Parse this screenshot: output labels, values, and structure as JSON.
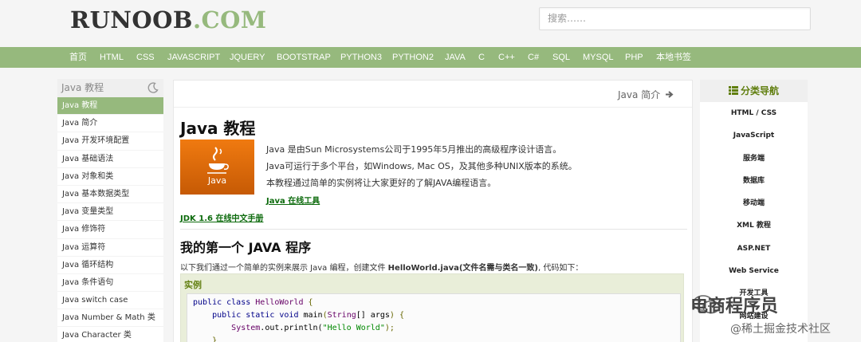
{
  "header": {
    "logo_part1": "RUNOOB",
    "logo_part2": ".COM",
    "search_placeholder": "搜索……"
  },
  "nav": {
    "items": [
      "首页",
      "HTML",
      "CSS",
      "JAVASCRIPT",
      "JQUERY",
      "BOOTSTRAP",
      "PYTHON3",
      "PYTHON2",
      "JAVA",
      "C",
      "C++",
      "C#",
      "SQL",
      "MYSQL",
      "PHP",
      "本地书签"
    ]
  },
  "sidebar": {
    "title": "Java 教程",
    "items": [
      "Java 教程",
      "Java 简介",
      "Java 开发环境配置",
      "Java 基础语法",
      "Java 对象和类",
      "Java 基本数据类型",
      "Java 变量类型",
      "Java 修饰符",
      "Java 运算符",
      "Java 循环结构",
      "Java 条件语句",
      "Java switch case",
      "Java Number & Math 类",
      "Java Character 类"
    ]
  },
  "main": {
    "next_link": "Java 简介",
    "title": "Java 教程",
    "logo_text": "Java",
    "intro": [
      "Java 是由Sun Microsystems公司于1995年5月推出的高级程序设计语言。",
      "Java可运行于多个平台，如Windows, Mac OS，及其他多种UNIX版本的系统。",
      "本教程通过简单的实例将让大家更好的了解JAVA编程语言。"
    ],
    "online_tool_link": "Java 在线工具",
    "jdk_link": "JDK 1.6 在线中文手册",
    "section_title": "我的第一个 JAVA 程序",
    "desc_before": "以下我们通过一个简单的实例来展示 Java 编程，创建文件 ",
    "desc_bold": "HelloWorld.java(文件名需与类名一致)",
    "desc_after": ", 代码如下：",
    "example_title": "实例",
    "code": {
      "l1_kw": "public class",
      "l1_type": "HelloWorld",
      "l1_end": "{",
      "l2_kw": "public static void",
      "l2_name": "main",
      "l2_paren": "(",
      "l2_type": "String",
      "l2_rest": "[] args",
      "l2_end": ") {",
      "l3_obj": "System",
      "l3_call": ".out.println(",
      "l3_str": "\"Hello World\"",
      "l3_end": ");",
      "l4": "}"
    }
  },
  "right_nav": {
    "title": "分类导航",
    "items": [
      "HTML / CSS",
      "JavaScript",
      "服务端",
      "数据库",
      "移动端",
      "XML 教程",
      "ASP.NET",
      "Web Service",
      "开发工具",
      "网站建设"
    ]
  },
  "watermark": {
    "line1": "电商程序员",
    "line2": "@稀土掘金技术社区"
  },
  "colors": {
    "brand_green": "#96b97d",
    "link_green": "#0d6b0d",
    "title_green": "#617f10",
    "java_orange": "#f07a10"
  }
}
